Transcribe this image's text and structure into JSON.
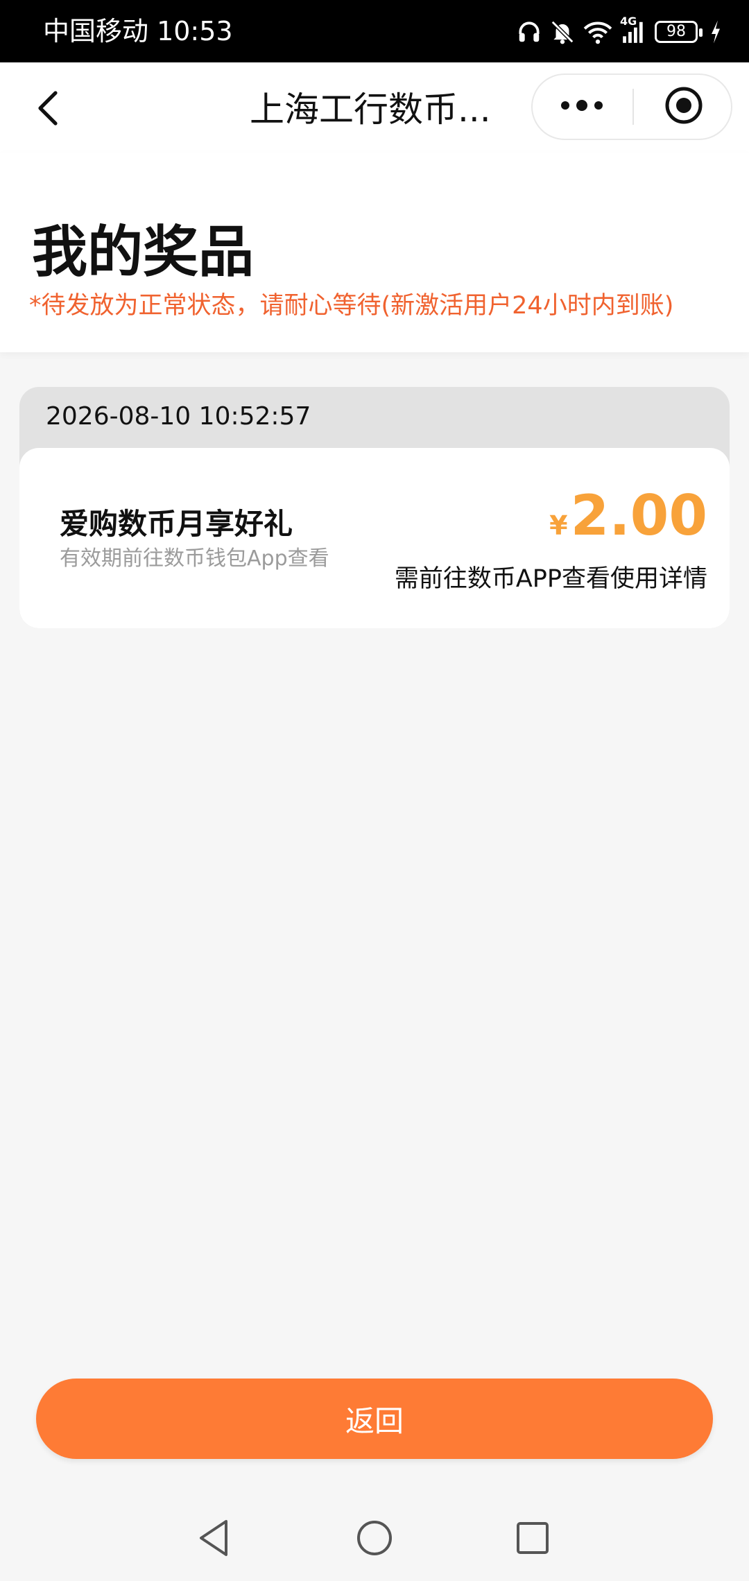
{
  "status_bar": {
    "carrier_time": "中国移动 10:53",
    "network": "4G",
    "battery": "98",
    "icons": [
      "headphones-icon",
      "bell-off-icon",
      "wifi-icon",
      "signal-icon",
      "battery-icon",
      "charging-icon"
    ]
  },
  "navbar": {
    "title": "上海工行数币...",
    "icons": [
      "back-arrow-icon",
      "more-dots-icon",
      "close-target-icon"
    ]
  },
  "header": {
    "title": "我的奖品",
    "notice": "*待发放为正常状态，请耐心等待(新激活用户24小时内到账)"
  },
  "records": [
    {
      "time": "2026-08-10 10:52:57",
      "prize_name": "爱购数币月享好礼",
      "prize_sub": "有效期前往数币钱包App查看",
      "currency": "¥",
      "amount": "2.00",
      "hint": "需前往数币APP查看使用详情"
    }
  ],
  "footer": {
    "return_label": "返回"
  },
  "system_nav": {
    "icons": [
      "nav-back-icon",
      "nav-home-icon",
      "nav-recent-icon"
    ]
  },
  "colors": {
    "accent_orange": "#fe7b35",
    "notice_orange": "#f0622f",
    "amount_orange": "#f8a23a"
  }
}
